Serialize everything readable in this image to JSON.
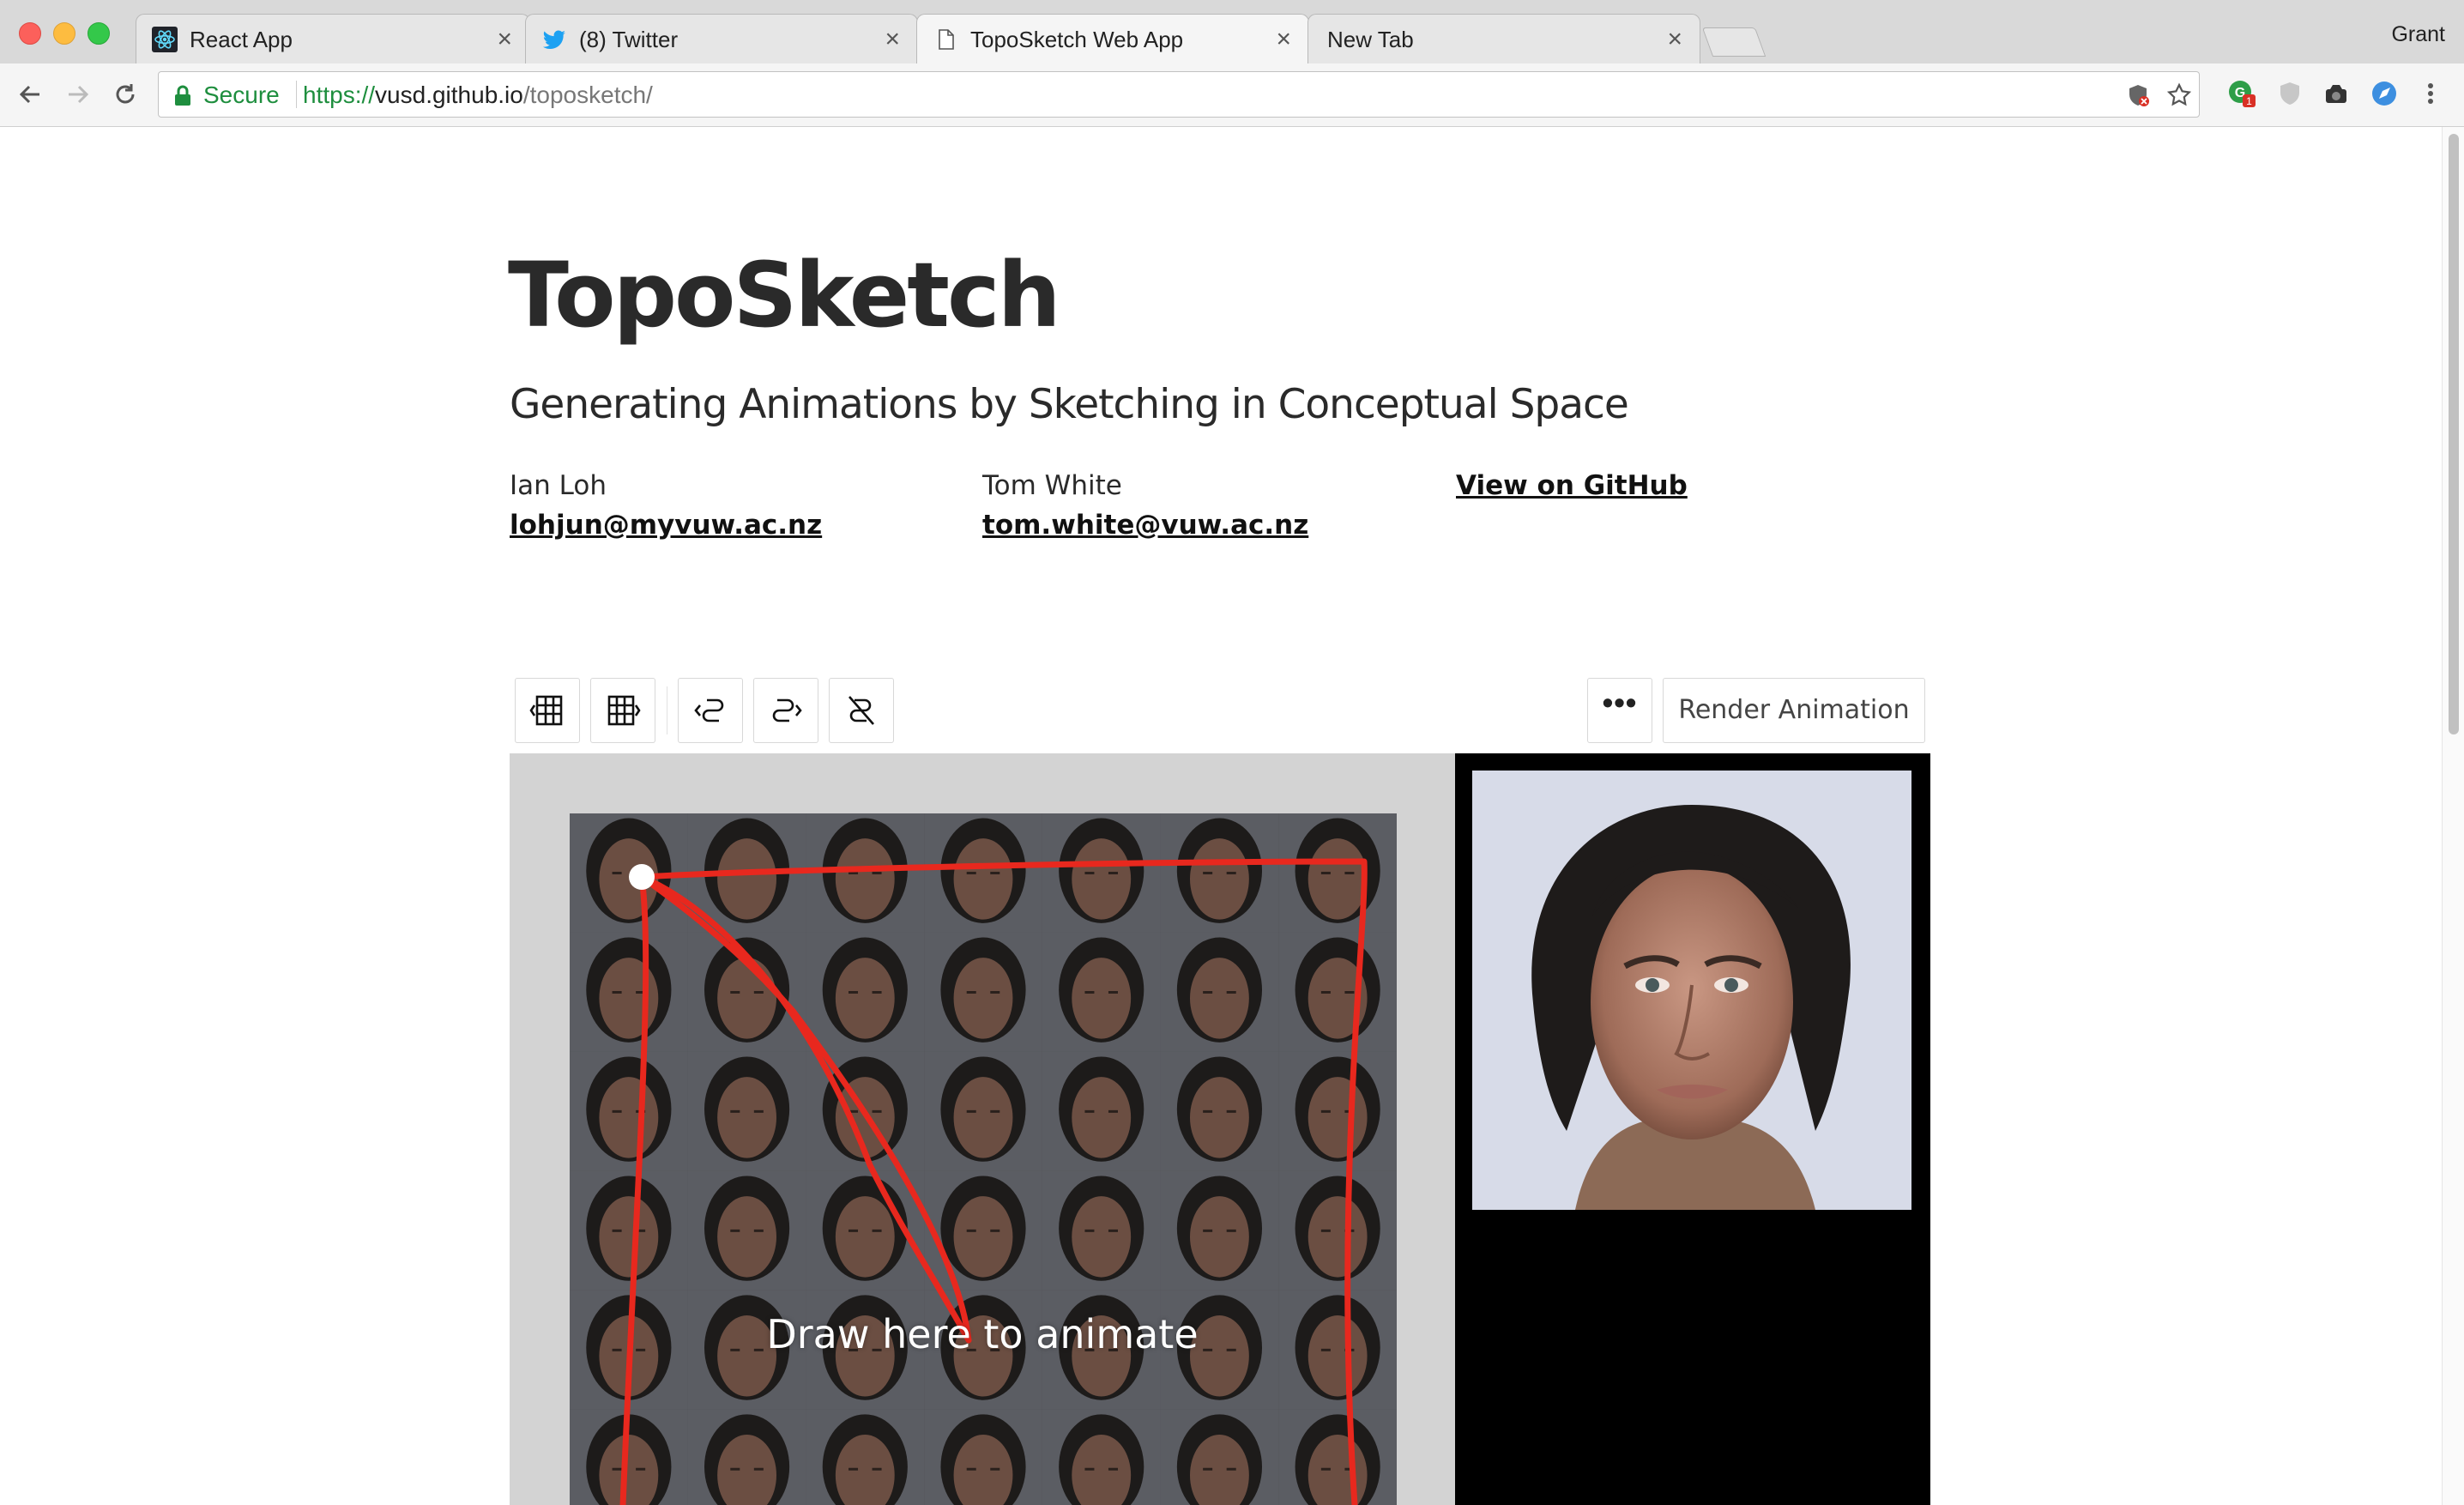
{
  "browser": {
    "tabs": [
      {
        "title": "React App",
        "icon": "react-icon",
        "close": "×"
      },
      {
        "title": "(8) Twitter",
        "icon": "twitter-icon",
        "close": "×"
      },
      {
        "title": "TopoSketch Web App",
        "icon": "document-icon",
        "close": "×"
      },
      {
        "title": "New Tab",
        "icon": "",
        "close": "×"
      }
    ],
    "profile_name": "Grant",
    "address_bar": {
      "secure_label": "Secure",
      "url_scheme": "https://",
      "url_host": "vusd.github.io",
      "url_path": "/toposketch/"
    },
    "extension_badge": "1"
  },
  "page": {
    "title": "TopoSketch",
    "subtitle": "Generating Animations by Sketching in Conceptual Space",
    "authors": [
      {
        "name": "Ian Loh",
        "email": "lohjun@myvuw.ac.nz"
      },
      {
        "name": "Tom White",
        "email": "tom.white@vuw.ac.nz"
      }
    ],
    "github_link": "View on GitHub"
  },
  "app": {
    "tools": [
      {
        "name": "grid-expand-icon"
      },
      {
        "name": "grid-shrink-icon"
      },
      {
        "name": "path-reverse-left-icon"
      },
      {
        "name": "path-reverse-right-icon"
      },
      {
        "name": "clear-path-icon"
      }
    ],
    "more_label": "•••",
    "render_label": "Render Animation",
    "draw_hint": "Draw here to animate",
    "colors": {
      "path": "#e8281e",
      "canvas_bg": "#d3d3d3",
      "preview_bg": "#000000"
    }
  }
}
